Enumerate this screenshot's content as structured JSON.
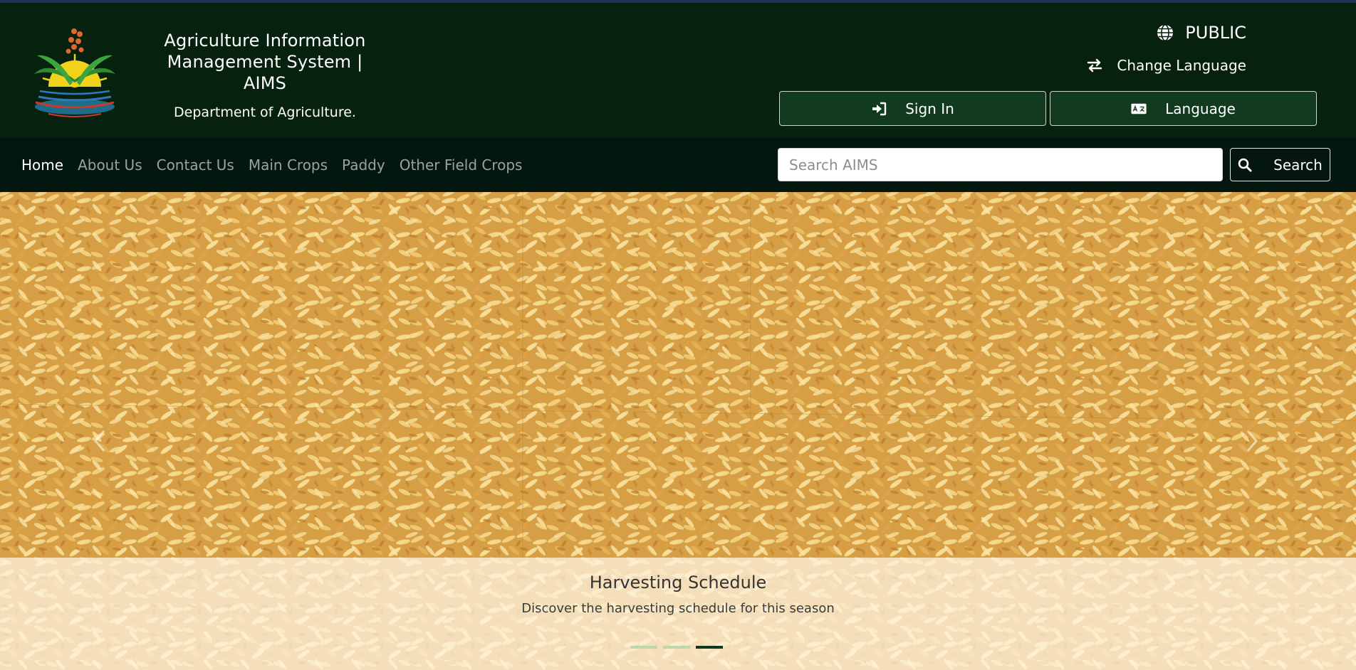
{
  "header": {
    "title": "Agriculture Information Management System | AIMS",
    "department": "Department of Agriculture.",
    "role": "PUBLIC",
    "change_language": "Change Language",
    "sign_in": "Sign In",
    "language": "Language"
  },
  "nav": {
    "items": [
      {
        "label": "Home",
        "active": true
      },
      {
        "label": "About Us",
        "active": false
      },
      {
        "label": "Contact Us",
        "active": false
      },
      {
        "label": "Main Crops",
        "active": false
      },
      {
        "label": "Paddy",
        "active": false
      },
      {
        "label": "Other Field Crops",
        "active": false
      }
    ]
  },
  "search": {
    "placeholder": "Search AIMS",
    "button": "Search"
  },
  "carousel": {
    "caption_title": "Harvesting Schedule",
    "caption_text": "Discover the harvesting schedule for this season",
    "slide_count": 3,
    "active_slide": 3
  },
  "icons": {
    "globe": "globe-icon",
    "exchange": "exchange-icon",
    "sign_in": "sign-in-icon",
    "language": "language-icon",
    "search": "search-icon",
    "prev": "chevron-left-icon",
    "next": "chevron-right-icon"
  },
  "colors": {
    "header_bg": "#07210f",
    "nav_bg": "#031610",
    "top_strip": "#1c3557",
    "button_bg": "#123a1f"
  }
}
